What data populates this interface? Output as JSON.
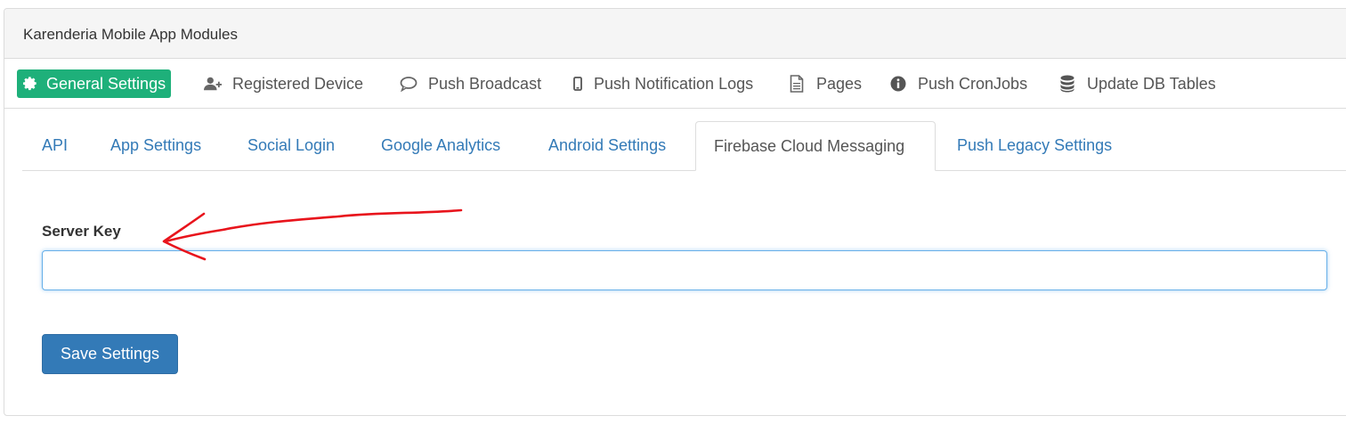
{
  "panel": {
    "title": "Karenderia Mobile App Modules"
  },
  "topnav": {
    "items": [
      {
        "label": "General Settings",
        "icon": "gear-icon",
        "active": true
      },
      {
        "label": "Registered Device",
        "icon": "user-plus-icon"
      },
      {
        "label": "Push Broadcast",
        "icon": "comment-icon"
      },
      {
        "label": "Push Notification Logs",
        "icon": "mobile-icon"
      },
      {
        "label": "Pages",
        "icon": "file-text-icon"
      },
      {
        "label": "Push CronJobs",
        "icon": "info-circle-icon"
      },
      {
        "label": "Update DB Tables",
        "icon": "database-icon"
      }
    ]
  },
  "tabs": {
    "items": [
      {
        "label": "API"
      },
      {
        "label": "App Settings"
      },
      {
        "label": "Social Login"
      },
      {
        "label": "Google Analytics"
      },
      {
        "label": "Android Settings"
      },
      {
        "label": "Firebase Cloud Messaging",
        "active": true
      },
      {
        "label": "Push Legacy Settings"
      }
    ]
  },
  "form": {
    "server_key_label": "Server Key",
    "server_key_value": "",
    "save_label": "Save Settings"
  },
  "colors": {
    "active_nav_bg": "#1eb07a",
    "link": "#337ab7",
    "primary_button": "#337ab7",
    "annotation": "#e8141c"
  }
}
